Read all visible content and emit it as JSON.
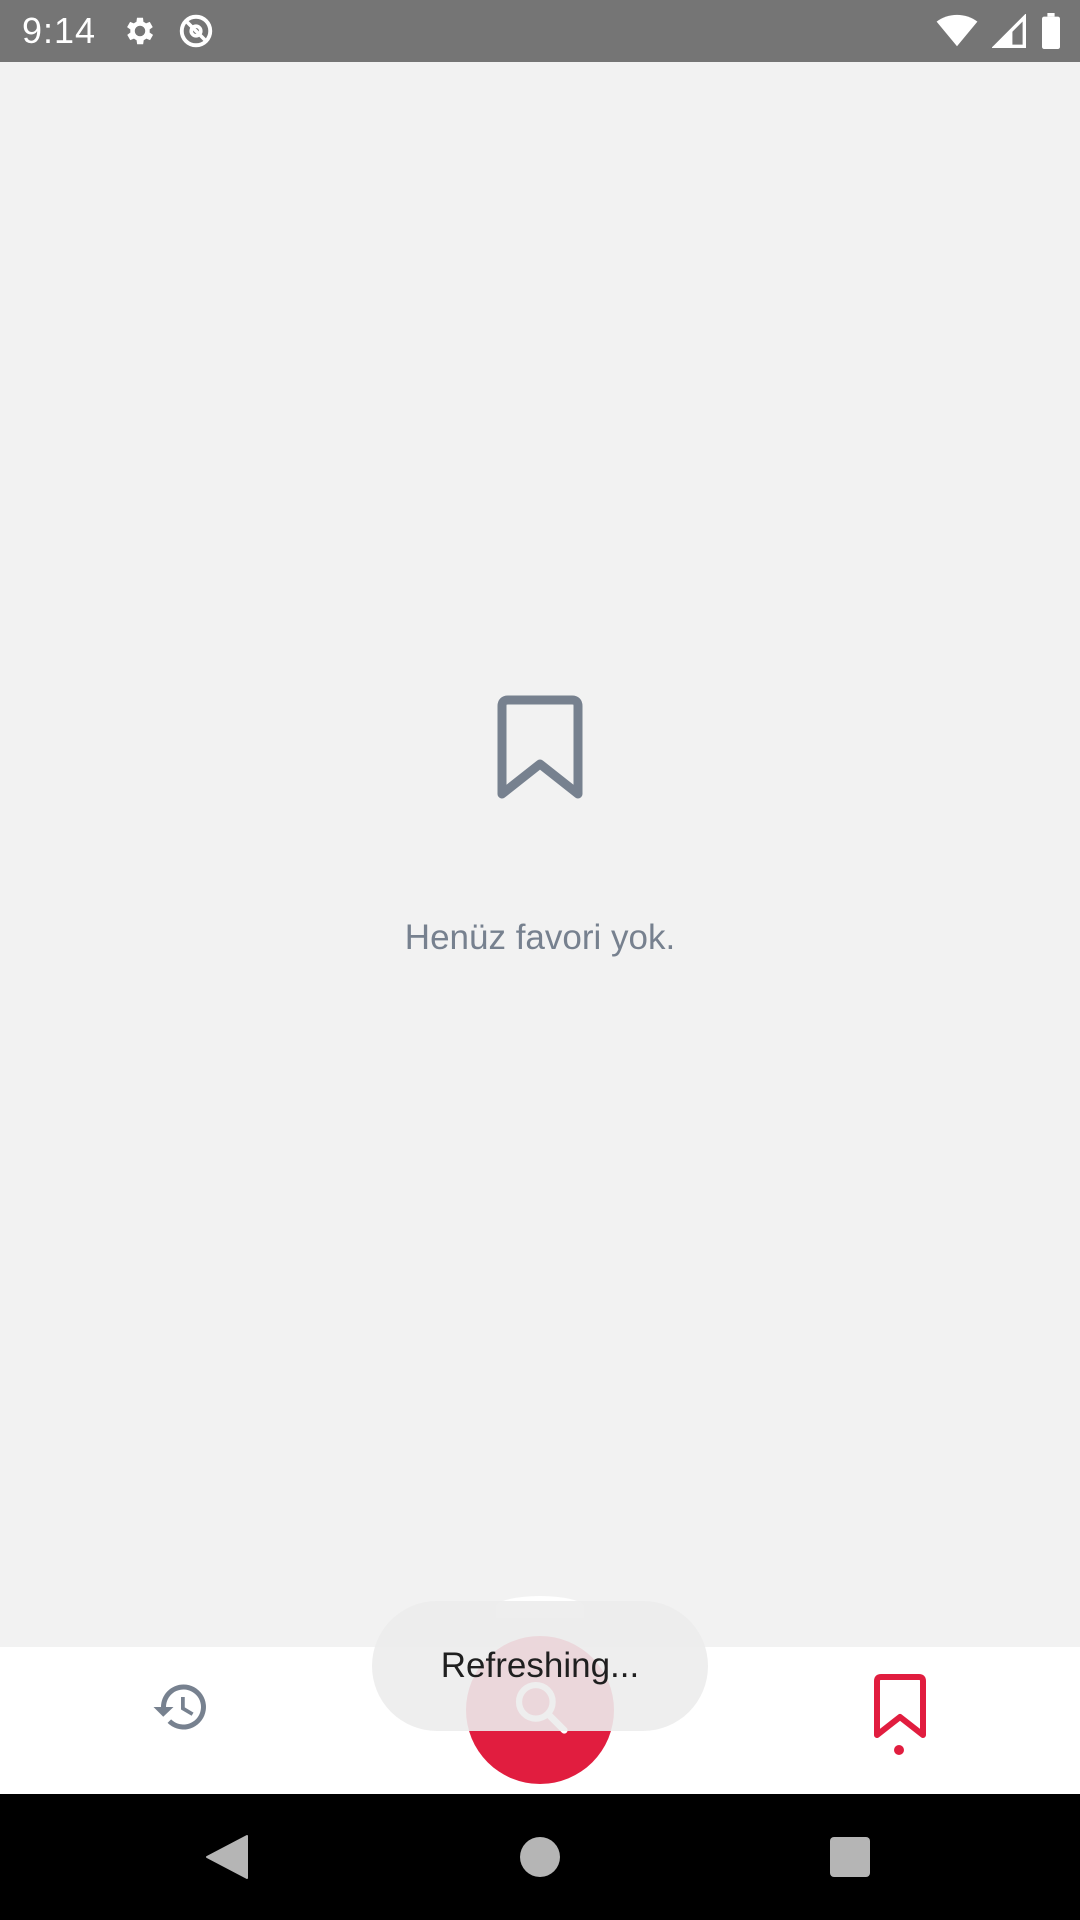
{
  "status_bar": {
    "time": "9:14",
    "left_icons": [
      "settings-gear-icon",
      "no-disturb-at-icon"
    ],
    "right_icons": [
      "wifi-icon",
      "cell-signal-icon",
      "battery-icon"
    ]
  },
  "empty_state": {
    "icon": "bookmark-outline-icon",
    "message": "Henüz favori yok."
  },
  "bottom_nav": {
    "items": [
      {
        "name": "history",
        "icon": "history-icon",
        "active": false
      },
      {
        "name": "search",
        "icon": "search-icon",
        "active": false
      },
      {
        "name": "favorites",
        "icon": "bookmark-icon",
        "active": true
      }
    ]
  },
  "toast": {
    "text": "Refreshing..."
  },
  "colors": {
    "accent": "#e11d3f",
    "muted_icon": "#77818f",
    "background": "#f2f2f2",
    "status_bar": "#757575"
  }
}
